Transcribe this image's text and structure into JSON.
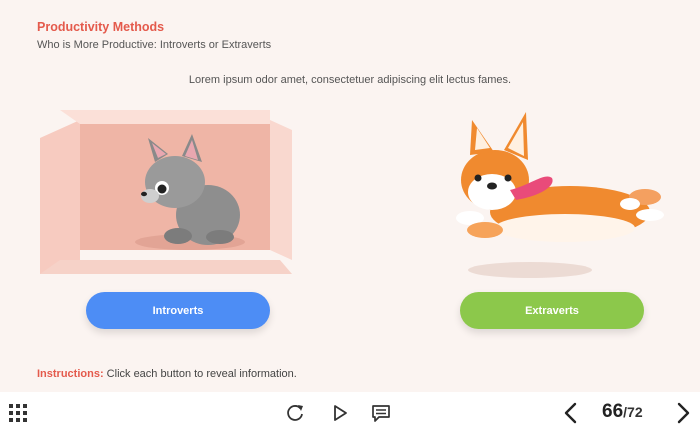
{
  "header": {
    "title": "Productivity Methods",
    "subtitle": "Who is More Productive: Introverts or Extraverts"
  },
  "lead_text": "Lorem ipsum odor amet, consectetuer adipiscing elit lectus fames.",
  "buttons": {
    "introverts": "Introverts",
    "extraverts": "Extraverts"
  },
  "instructions": {
    "label": "Instructions:",
    "text": " Click each button to reveal information."
  },
  "pager": {
    "current": "66",
    "separator": "/",
    "total": "72"
  },
  "colors": {
    "accent": "#e45a4c",
    "introverts_button": "#4d8df5",
    "extraverts_button": "#8cc84b"
  },
  "icons": [
    "menu-grid-icon",
    "replay-icon",
    "play-icon",
    "captions-icon",
    "chevron-left-icon",
    "chevron-right-icon"
  ]
}
